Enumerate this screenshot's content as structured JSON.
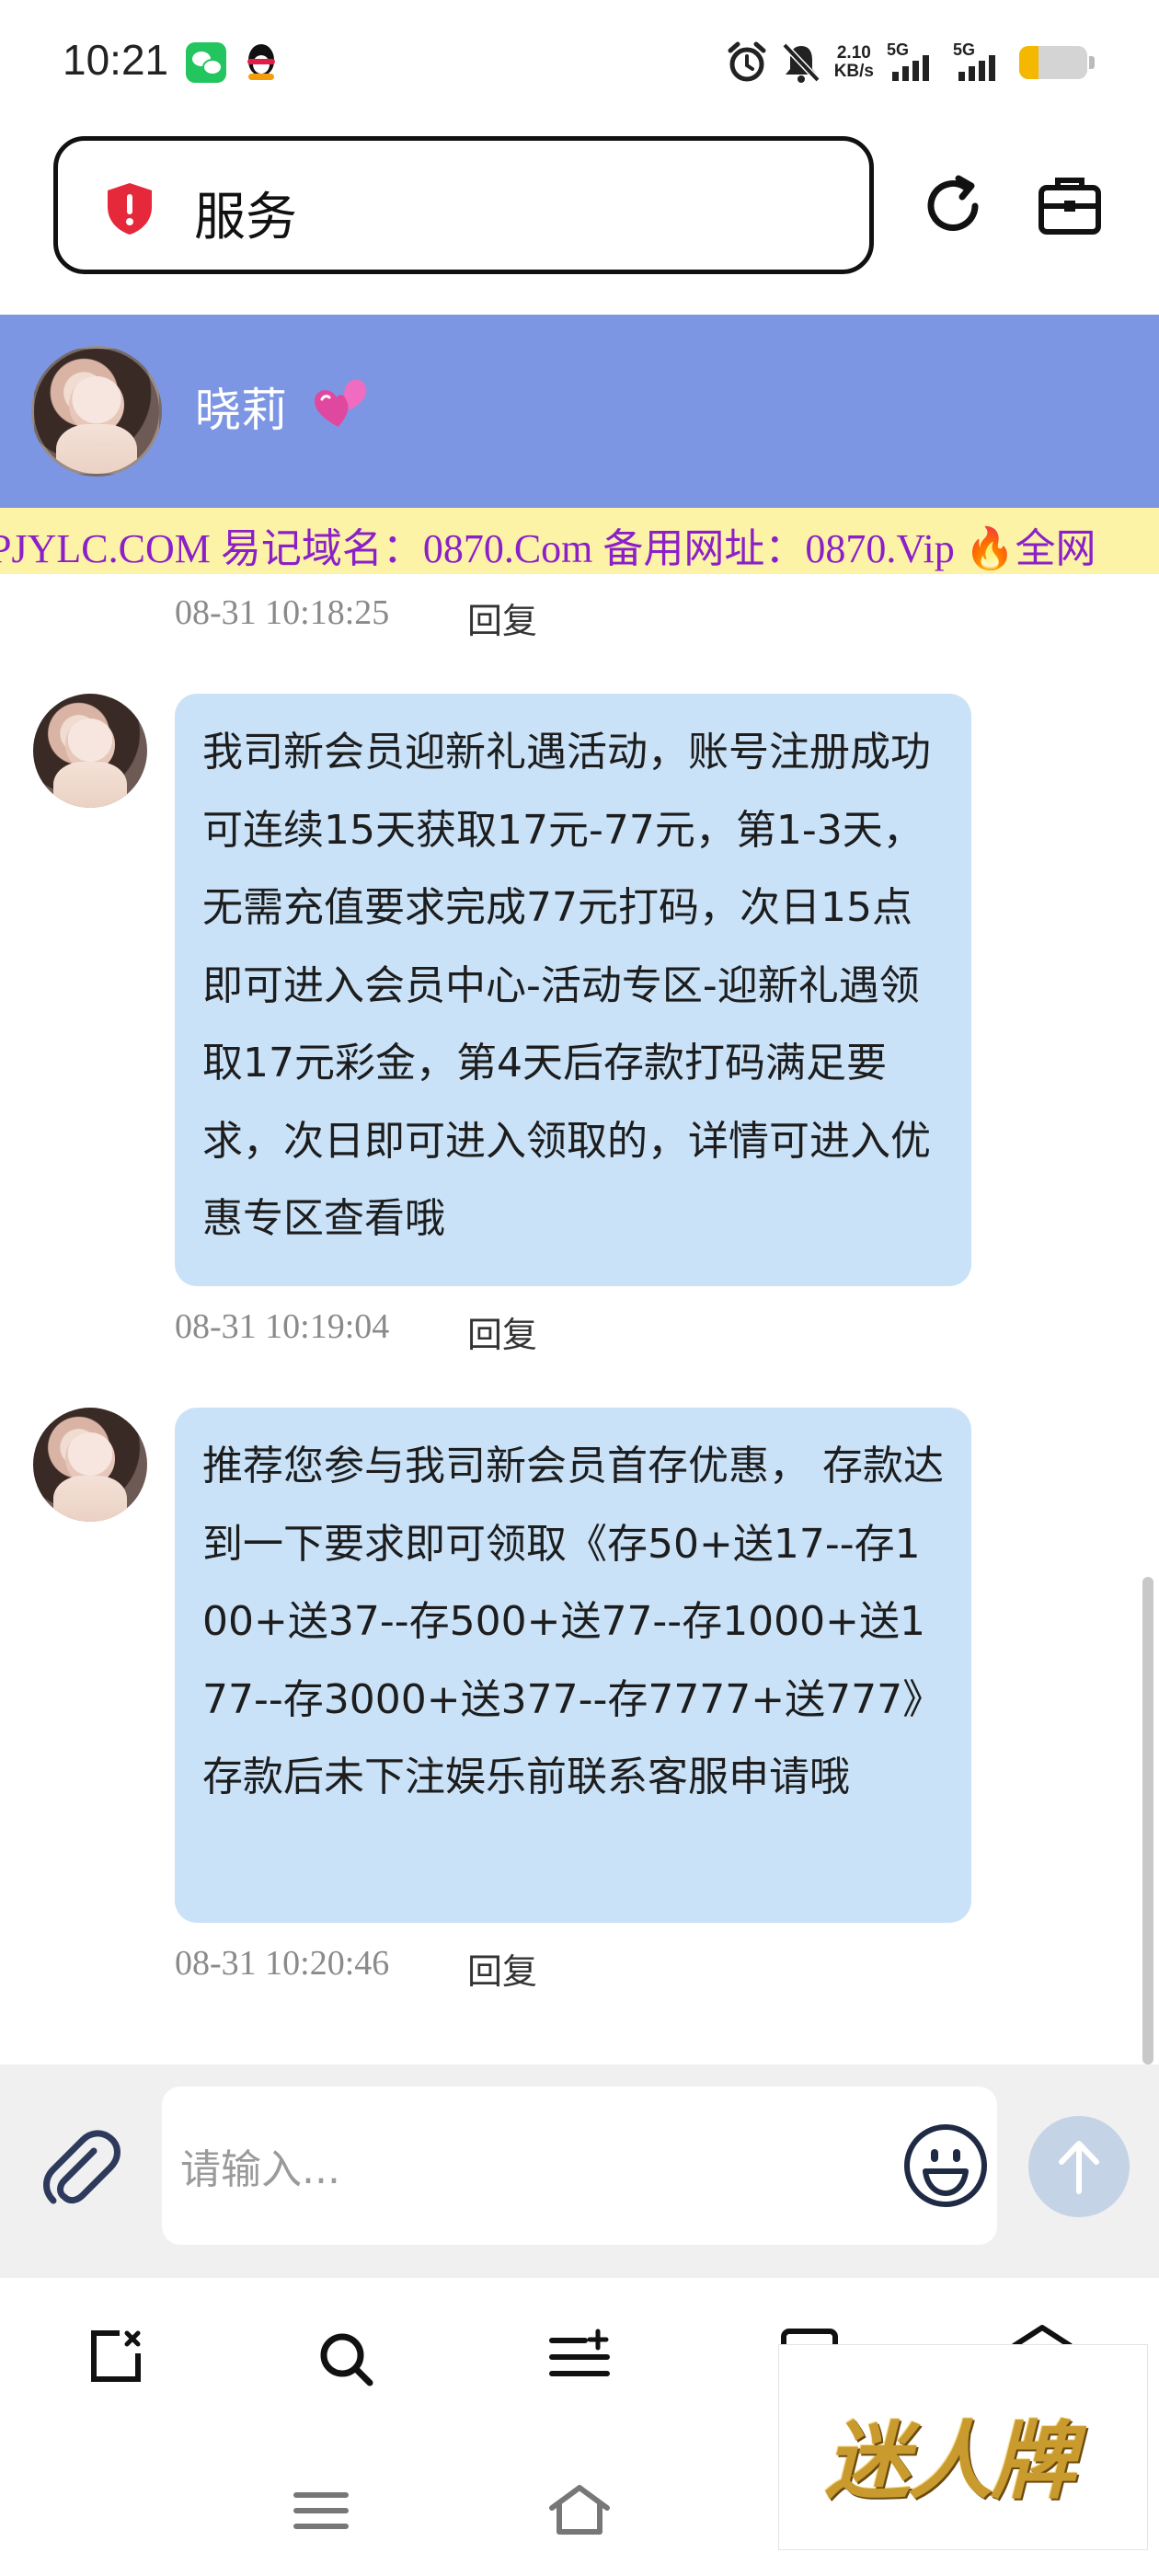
{
  "status_bar": {
    "time": "10:21",
    "net_speed_value": "2.10",
    "net_speed_unit": "KB/s",
    "signal1_label": "5G",
    "signal2_label": "5G",
    "battery_level": 0.28,
    "icons": [
      "wechat-icon",
      "qq-icon",
      "alarm-icon",
      "mute-bell-icon",
      "signal-icon",
      "battery-icon"
    ]
  },
  "browser": {
    "url_text": "服务",
    "security_icon": "shield-alert-icon",
    "reload_icon": "reload-icon",
    "tabs_icon": "tab-box-icon"
  },
  "chat_header": {
    "name": "晓莉",
    "emoji_icon": "two-hearts-icon",
    "color": "#7d96e4"
  },
  "marquee": {
    "text": "PJYLC.COM 易记域名：0870.Com 备用网址：0870.Vip 🔥全网",
    "text_color": "#8c20c8",
    "bg_color": "#fdf3a6"
  },
  "chat": {
    "reply_label": "回复",
    "previous": {
      "timestamp": "08-31 10:18:25"
    },
    "messages": [
      {
        "text": "我司新会员迎新礼遇活动，账号注册成功可连续15天获取17元-77元，第1-3天，无需充值要求完成77元打码，次日15点即可进入会员中心-活动专区-迎新礼遇领取17元彩金，第4天后存款打码满足要求，次日即可进入领取的，详情可进入优惠专区查看哦",
        "timestamp": "08-31 10:19:04"
      },
      {
        "text": "推荐您参与我司新会员首存优惠， 存款达到一下要求即可领取《存50+送17--存100+送37--存500+送77--存1000+送177--存3000+送377--存7777+送777》存款后未下注娱乐前联系客服申请哦",
        "timestamp": "08-31 10:20:46"
      }
    ],
    "bubble_color": "#cae2f8"
  },
  "input_bar": {
    "placeholder": "请输入...",
    "attach_icon": "paperclip-icon",
    "emoji_icon": "smiley-icon",
    "send_icon": "arrow-up-icon"
  },
  "toolbar": {
    "icons": [
      "new-tab-icon",
      "search-icon",
      "menu-list-icon",
      "tabs-icon",
      "home-icon",
      "hamburger-menu-icon",
      "home-outline-icon"
    ]
  },
  "watermark": {
    "text": "迷人牌"
  }
}
